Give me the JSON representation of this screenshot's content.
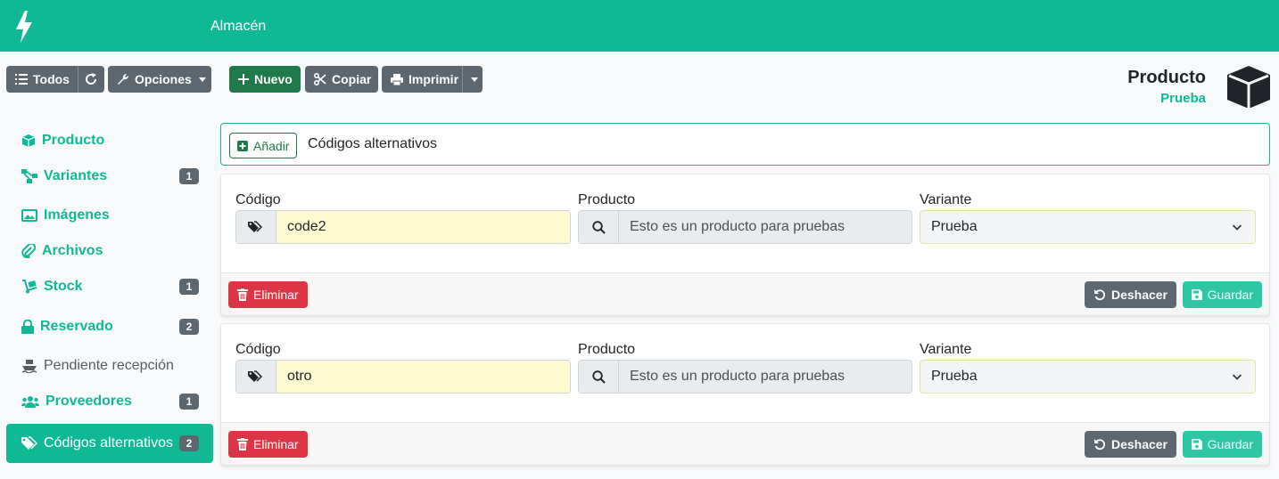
{
  "app": {
    "menu_title": "Almacén"
  },
  "toolbar": {
    "todos": "Todos",
    "opciones": "Opciones",
    "nuevo": "Nuevo",
    "copiar": "Copiar",
    "imprimir": "Imprimir"
  },
  "header": {
    "title": "Producto",
    "subtitle": "Prueba"
  },
  "sidebar": {
    "items": [
      {
        "label": "Producto",
        "icon": "cube-icon",
        "badge": ""
      },
      {
        "label": "Variantes",
        "icon": "sitemap-icon",
        "badge": "1"
      },
      {
        "label": "Imágenes",
        "icon": "images-icon",
        "badge": ""
      },
      {
        "label": "Archivos",
        "icon": "paperclip-icon",
        "badge": ""
      },
      {
        "label": "Stock",
        "icon": "dolly-icon",
        "badge": "1"
      },
      {
        "label": "Reservado",
        "icon": "lock-icon",
        "badge": "2"
      },
      {
        "label": "Pendiente recepción",
        "icon": "ship-icon",
        "badge": ""
      },
      {
        "label": "Proveedores",
        "icon": "users-icon",
        "badge": "1"
      },
      {
        "label": "Códigos alternativos",
        "icon": "tags-icon",
        "badge": "2"
      }
    ]
  },
  "add_bar": {
    "button": "Añadir",
    "title": "Códigos alternativos"
  },
  "labels": {
    "codigo": "Código",
    "producto": "Producto",
    "variante": "Variante"
  },
  "actions": {
    "eliminar": "Eliminar",
    "deshacer": "Deshacer",
    "guardar": "Guardar"
  },
  "records": [
    {
      "codigo": "code2",
      "producto": "Esto es un producto para pruebas",
      "variante": "Prueba"
    },
    {
      "codigo": "otro",
      "producto": "Esto es un producto para pruebas",
      "variante": "Prueba"
    }
  ],
  "colors": {
    "brand": "#10b996",
    "danger": "#dc3545",
    "secondary": "#5c6770",
    "success": "#1e7a48"
  }
}
